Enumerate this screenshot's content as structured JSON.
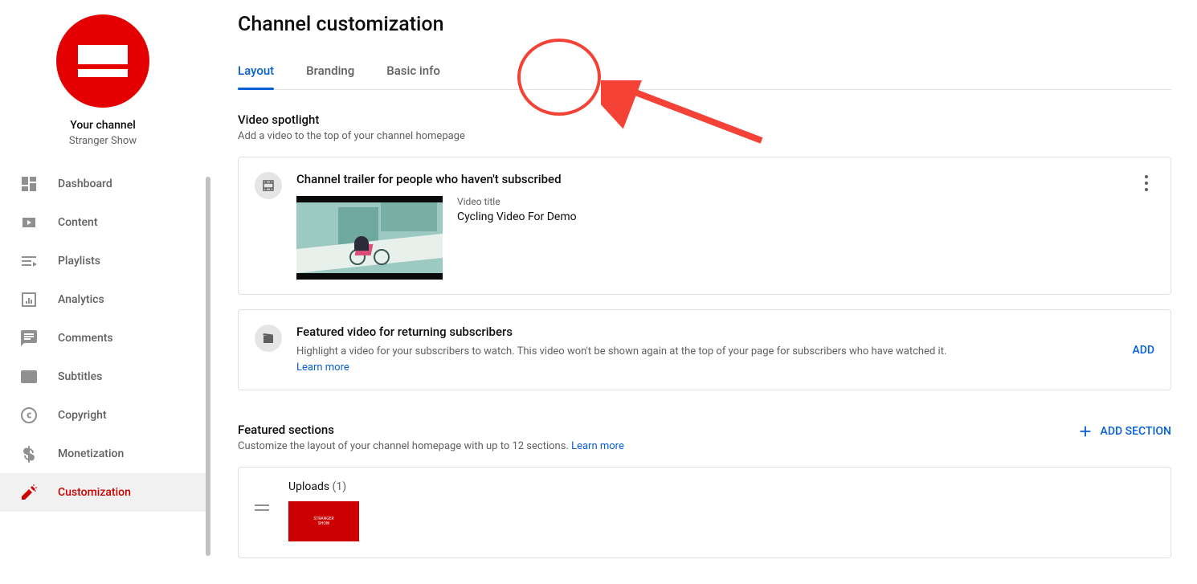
{
  "sidebar": {
    "your_channel_label": "Your channel",
    "channel_name": "Stranger Show",
    "items": [
      {
        "label": "Dashboard"
      },
      {
        "label": "Content"
      },
      {
        "label": "Playlists"
      },
      {
        "label": "Analytics"
      },
      {
        "label": "Comments"
      },
      {
        "label": "Subtitles"
      },
      {
        "label": "Copyright"
      },
      {
        "label": "Monetization"
      },
      {
        "label": "Customization"
      }
    ]
  },
  "page": {
    "title": "Channel customization"
  },
  "tabs": {
    "layout": "Layout",
    "branding": "Branding",
    "basic_info": "Basic info"
  },
  "spotlight": {
    "title": "Video spotlight",
    "sub": "Add a video to the top of your channel homepage"
  },
  "trailer": {
    "title": "Channel trailer for people who haven't subscribed",
    "meta_label": "Video title",
    "meta_value": "Cycling Video For Demo"
  },
  "featured_returning": {
    "title": "Featured video for returning subscribers",
    "desc": "Highlight a video for your subscribers to watch. This video won't be shown again at the top of your page for subscribers who have watched it.  ",
    "learn_more": "Learn more",
    "add": "ADD"
  },
  "sections": {
    "title": "Featured sections",
    "sub": "Customize the layout of your channel homepage with up to 12 sections. ",
    "learn_more": "Learn more",
    "add_section": "ADD SECTION",
    "uploads_label": "Uploads",
    "uploads_count": " (1)"
  }
}
